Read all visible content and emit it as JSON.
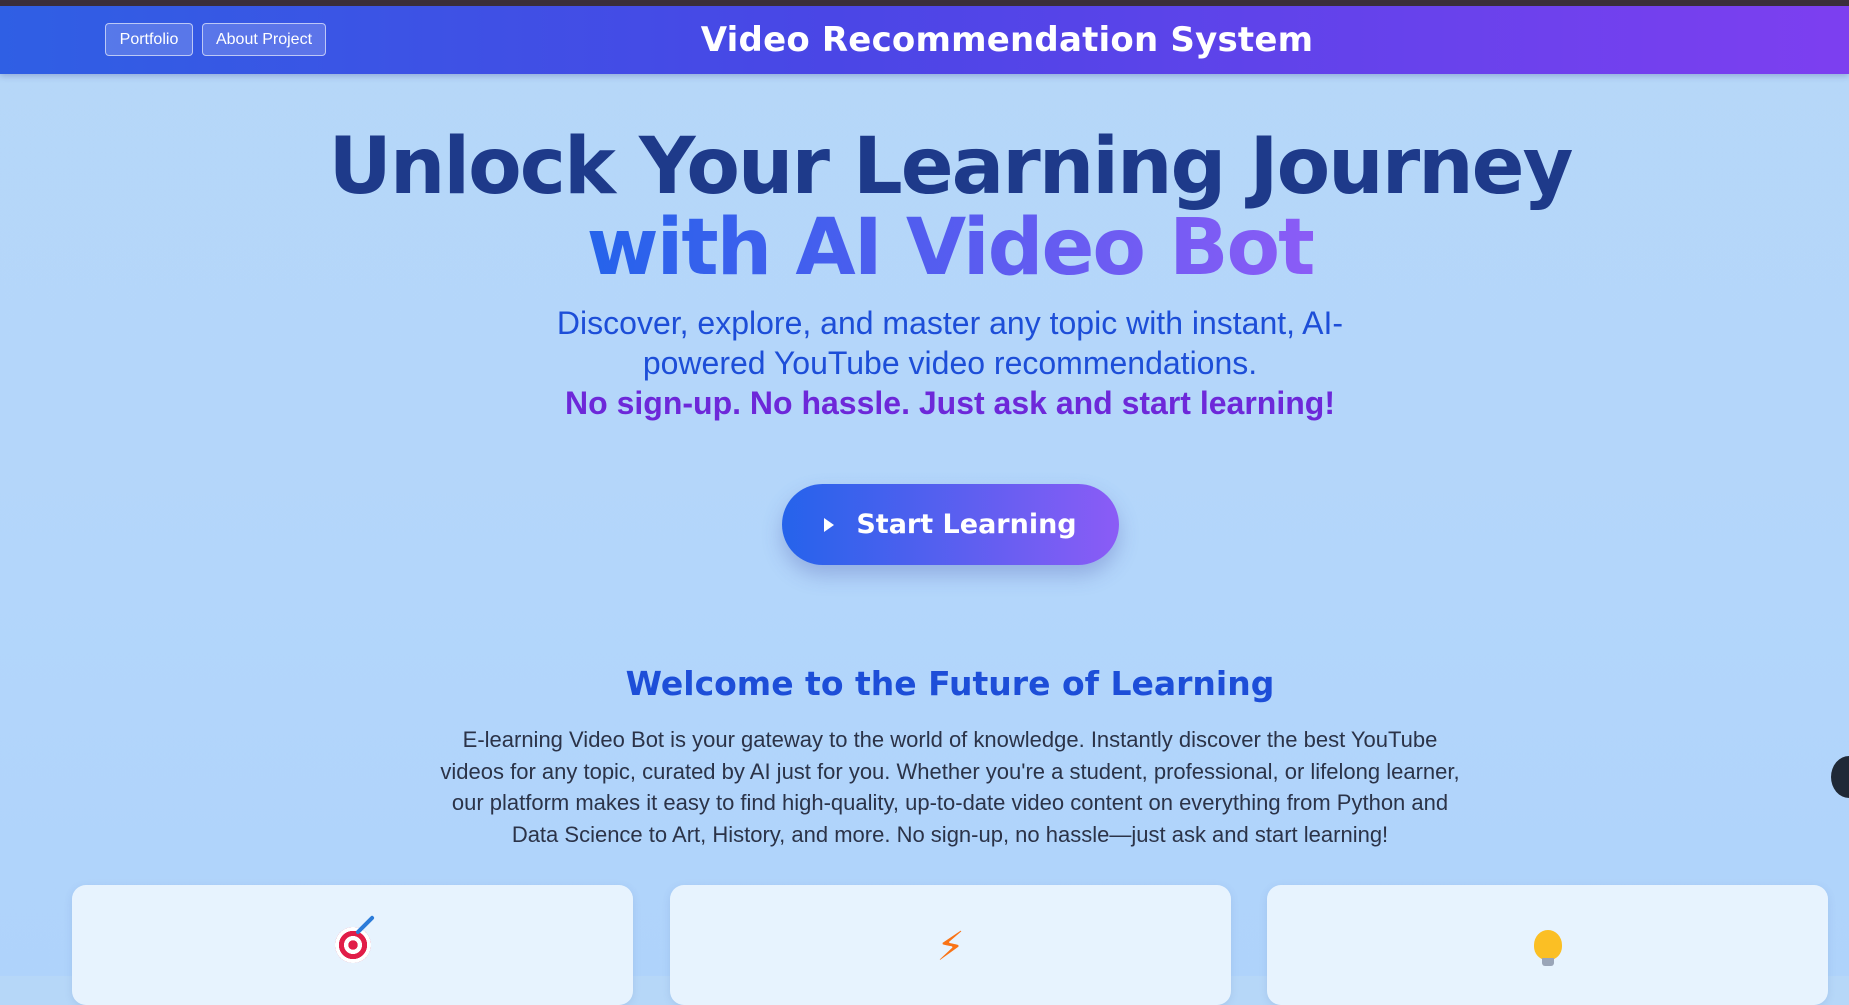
{
  "header": {
    "nav": [
      {
        "label": "Portfolio"
      },
      {
        "label": "About Project"
      }
    ],
    "title": "Video Recommendation System"
  },
  "hero": {
    "headline_line1": "Unlock Your Learning Journey",
    "headline_line2": "with AI Video Bot",
    "subtitle_line1": "Discover, explore, and master any topic with instant, AI-",
    "subtitle_line2": "powered YouTube video recommendations.",
    "tagline": "No sign-up. No hassle. Just ask and start learning!",
    "cta_label": "Start Learning",
    "cta_icon": "play-icon"
  },
  "welcome": {
    "heading": "Welcome to the Future of Learning",
    "body": "E-learning Video Bot is your gateway to the world of knowledge. Instantly discover the best YouTube videos for any topic, curated by AI just for you. Whether you're a student, professional, or lifelong learner, our platform makes it easy to find high-quality, up-to-date video content on everything from Python and Data Science to Art, History, and more. No sign-up, no hassle—just ask and start learning!"
  },
  "features": [
    {
      "icon": "target-icon"
    },
    {
      "icon": "lightning-icon"
    },
    {
      "icon": "lightbulb-icon"
    }
  ],
  "colors": {
    "header_start": "#2f5fe4",
    "header_end": "#7d3ff0",
    "headline": "#1e3a8a",
    "accent_blue": "#1d4ed8",
    "accent_purple": "#6d28d9"
  }
}
